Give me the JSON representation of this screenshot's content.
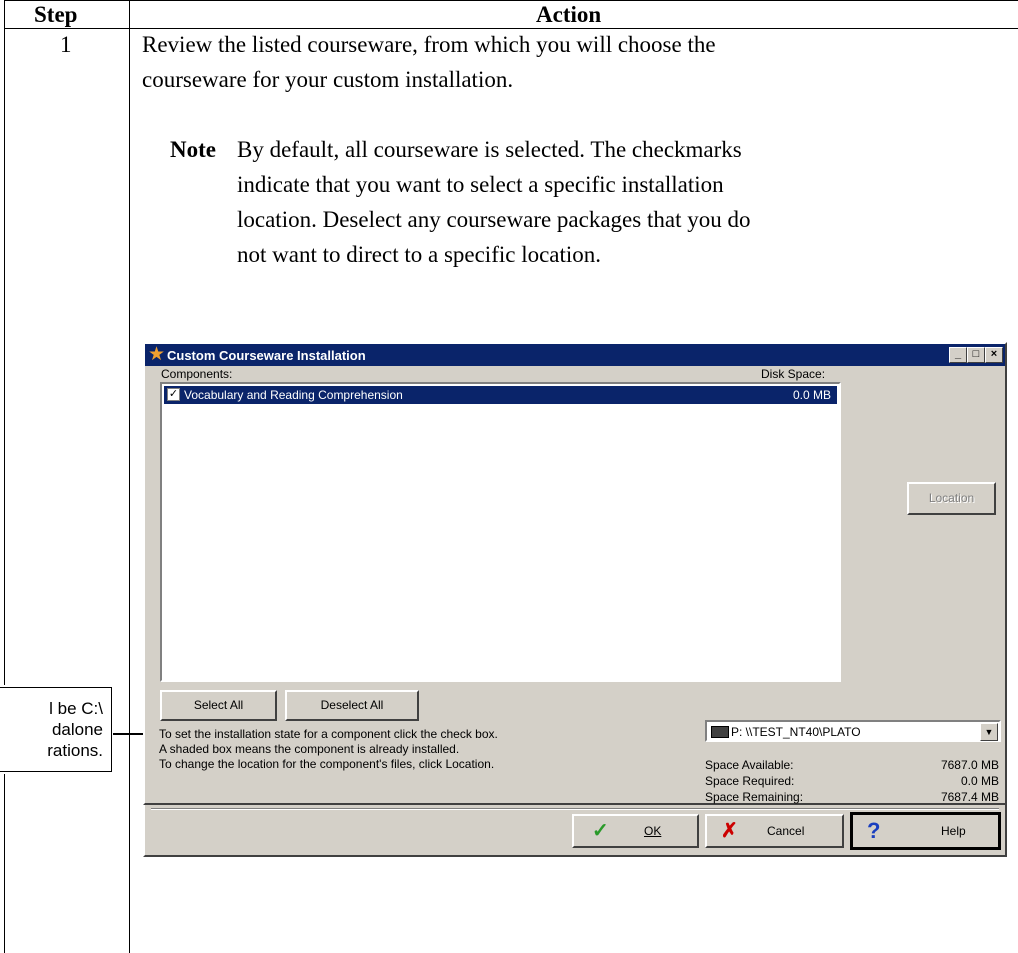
{
  "table": {
    "header_step": "Step",
    "header_action": "Action",
    "step_number": "1",
    "line1": "Review the listed courseware, from which you will choose the",
    "line2": "courseware for your custom installation.",
    "note_label": "Note",
    "note_lines": [
      "By default, all courseware is selected.  The checkmarks",
      "indicate that you want to select a specific installation",
      "location.  Deselect any courseware packages that you do",
      "not want to direct to a specific location."
    ]
  },
  "callout": {
    "text": "l be C:\\\ndalone\nrations."
  },
  "dialog": {
    "title": "Custom Courseware Installation",
    "title_buttons": [
      "_",
      "□",
      "×"
    ],
    "components_label": "Components:",
    "disk_space_label": "Disk Space:",
    "components": [
      {
        "name": "Vocabulary and Reading Comprehension",
        "size": "0.0 MB",
        "checked": true
      }
    ],
    "location_button": "Location",
    "select_all": "Select All",
    "deselect_all": "Deselect All",
    "instructions": [
      "To set the installation state for a component click the check box.",
      "A shaded box means the component is already installed.",
      "To change the location for the component's files, click Location."
    ],
    "drive": "P: \\\\TEST_NT40\\PLATO",
    "space": [
      {
        "label": "Space Available:",
        "value": "7687.0 MB"
      },
      {
        "label": "Space Required:",
        "value": "0.0 MB"
      },
      {
        "label": "Space Remaining:",
        "value": "7687.4 MB"
      }
    ],
    "ok_button": "OK",
    "cancel_button": "Cancel",
    "help_button": "Help"
  },
  "colors": {
    "titlebar": "#0a246a",
    "dialog_face": "#d4d0c8",
    "ok_check": "#2a9a2a",
    "cancel_x": "#cc0000",
    "help_q": "#1a3fbf"
  }
}
